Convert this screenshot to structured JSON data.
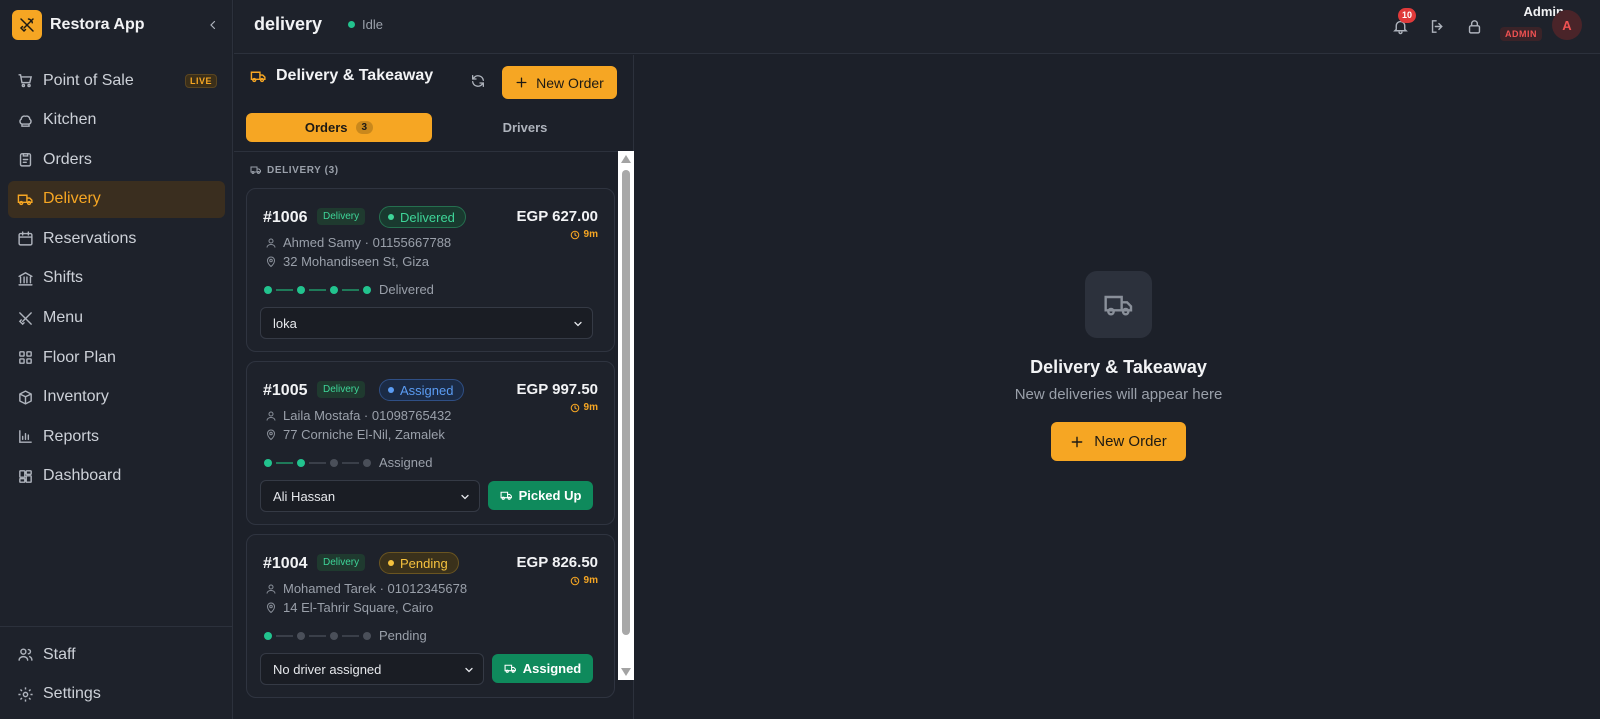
{
  "app": {
    "name": "Restora App"
  },
  "sidebar": {
    "items": [
      {
        "label": "Point of Sale",
        "icon": "cart-icon",
        "badge": "LIVE"
      },
      {
        "label": "Kitchen",
        "icon": "chef-hat-icon"
      },
      {
        "label": "Orders",
        "icon": "clipboard-icon"
      },
      {
        "label": "Delivery",
        "icon": "truck-icon",
        "active": true
      },
      {
        "label": "Reservations",
        "icon": "calendar-icon"
      },
      {
        "label": "Shifts",
        "icon": "bank-icon"
      },
      {
        "label": "Menu",
        "icon": "utensils-icon"
      },
      {
        "label": "Floor Plan",
        "icon": "grid-icon"
      },
      {
        "label": "Inventory",
        "icon": "box-icon"
      },
      {
        "label": "Reports",
        "icon": "bar-chart-icon"
      },
      {
        "label": "Dashboard",
        "icon": "dashboard-icon"
      }
    ],
    "bottom": [
      {
        "label": "Staff",
        "icon": "users-icon"
      },
      {
        "label": "Settings",
        "icon": "gear-icon"
      }
    ]
  },
  "header": {
    "title": "delivery",
    "status": "Idle",
    "notifications": "10",
    "user": {
      "name": "Admin",
      "role": "ADMIN",
      "initial": "A"
    }
  },
  "panel": {
    "title": "Delivery & Takeaway",
    "new_order_label": "New Order",
    "tabs": [
      {
        "label": "Orders",
        "count": "3"
      },
      {
        "label": "Drivers"
      }
    ],
    "section_label": "DELIVERY (3)",
    "orders": [
      {
        "number": "#1006",
        "type": "Delivery",
        "status": "Delivered",
        "price": "EGP 627.00",
        "elapsed": "9m",
        "customer": "Ahmed Samy · 01155667788",
        "address": "32 Mohandiseen St, Giza",
        "progress_label": "Delivered",
        "driver": "loka"
      },
      {
        "number": "#1005",
        "type": "Delivery",
        "status": "Assigned",
        "price": "EGP 997.50",
        "elapsed": "9m",
        "customer": "Laila Mostafa · 01098765432",
        "address": "77 Corniche El-Nil, Zamalek",
        "progress_label": "Assigned",
        "driver": "Ali Hassan",
        "action": "Picked Up"
      },
      {
        "number": "#1004",
        "type": "Delivery",
        "status": "Pending",
        "price": "EGP 826.50",
        "elapsed": "9m",
        "customer": "Mohamed Tarek · 01012345678",
        "address": "14 El-Tahrir Square, Cairo",
        "progress_label": "Pending",
        "driver": "No driver assigned",
        "action": "Assigned"
      }
    ]
  },
  "empty_state": {
    "title": "Delivery & Takeaway",
    "subtitle": "New deliveries will appear here",
    "button": "New Order"
  },
  "colors": {
    "accent": "#f6a623",
    "success": "#22c38e",
    "danger": "#e03a3a",
    "info": "#5b9cf2"
  }
}
